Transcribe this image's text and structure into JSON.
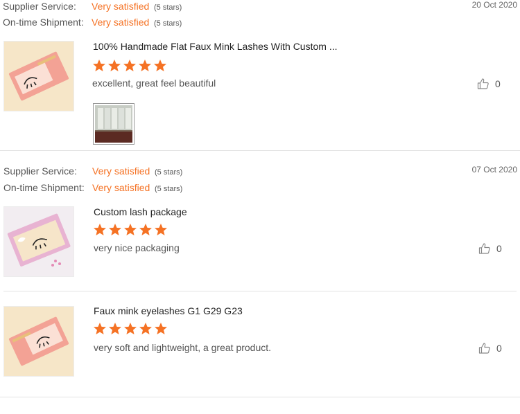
{
  "reviews": [
    {
      "supplier_label": "Supplier Service:",
      "supplier_value": "Very satisfied",
      "supplier_stars": "(5 stars)",
      "shipment_label": "On-time Shipment:",
      "shipment_value": "Very satisfied",
      "shipment_stars": "(5 stars)",
      "date": "20 Oct 2020",
      "product_title": "100% Handmade Flat Faux Mink Lashes With Custom ...",
      "rating": 5,
      "text": "excellent, great feel beautiful",
      "likes": "0",
      "thumb_colors": [
        "#f4a99a",
        "#f0c080"
      ]
    },
    {
      "supplier_label": "Supplier Service:",
      "supplier_value": "Very satisfied",
      "supplier_stars": "(5 stars)",
      "shipment_label": "On-time Shipment:",
      "shipment_value": "Very satisfied",
      "shipment_stars": "(5 stars)",
      "date": "07 Oct 2020",
      "product_title": "Custom lash package",
      "rating": 5,
      "text": "very nice packaging",
      "likes": "0",
      "thumb_colors": [
        "#e9bfd7",
        "#f1e7ef"
      ]
    },
    {
      "product_title": "Faux mink eyelashes G1 G29 G23",
      "rating": 5,
      "text": "very soft and lightweight, a great product.",
      "likes": "0",
      "thumb_colors": [
        "#f4a99a",
        "#f0c080"
      ]
    }
  ],
  "colors": {
    "accent": "#f57224",
    "text": "#333333",
    "muted": "#555555",
    "divider": "#e2e2e2"
  },
  "icons": {
    "star": "star-icon",
    "like": "thumbs-up-icon"
  }
}
